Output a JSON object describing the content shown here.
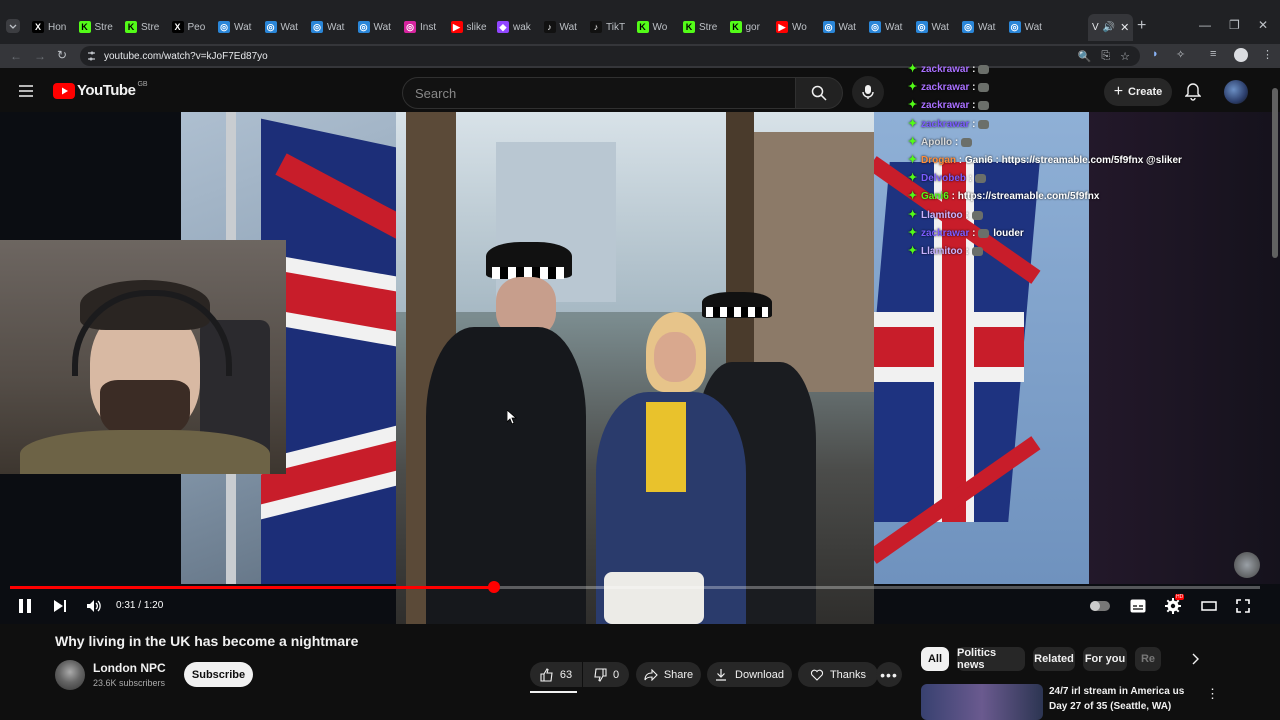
{
  "browser": {
    "tabs": [
      {
        "icon": "x",
        "label": "Hon"
      },
      {
        "icon": "kick",
        "label": "Stre"
      },
      {
        "icon": "kick",
        "label": "Stre"
      },
      {
        "icon": "x",
        "label": "Peo"
      },
      {
        "icon": "wat",
        "label": "Wat"
      },
      {
        "icon": "wat",
        "label": "Wat"
      },
      {
        "icon": "wat",
        "label": "Wat"
      },
      {
        "icon": "wat",
        "label": "Wat"
      },
      {
        "icon": "insta",
        "label": "Inst"
      },
      {
        "icon": "yt",
        "label": "slike"
      },
      {
        "icon": "twitch",
        "label": "wak"
      },
      {
        "icon": "tiktok",
        "label": "Wat"
      },
      {
        "icon": "tiktok",
        "label": "TikT"
      },
      {
        "icon": "kick",
        "label": "Wo"
      },
      {
        "icon": "kick",
        "label": "Stre"
      },
      {
        "icon": "kick",
        "label": "gor"
      },
      {
        "icon": "yt",
        "label": "Wo"
      },
      {
        "icon": "wat",
        "label": "Wat"
      },
      {
        "icon": "wat",
        "label": "Wat"
      },
      {
        "icon": "wat",
        "label": "Wat"
      },
      {
        "icon": "wat",
        "label": "Wat"
      },
      {
        "icon": "wat",
        "label": "Wat"
      }
    ],
    "active_tab_label": "V",
    "url": "youtube.com/watch?v=kJoF7Ed87yo"
  },
  "youtube": {
    "logo_text": "YouTube",
    "region": "GB",
    "search_placeholder": "Search",
    "create_label": "Create"
  },
  "chat": [
    {
      "user": "zackrawar",
      "msg": "",
      "color": "#a970ff"
    },
    {
      "user": "zackrawar",
      "msg": "",
      "color": "#a970ff"
    },
    {
      "user": "zackrawar",
      "msg": "",
      "color": "#a970ff"
    },
    {
      "user": "zackrawar",
      "msg": "",
      "color": "#7a5cff"
    },
    {
      "user": "Apollo",
      "msg": "",
      "color": "#d9d9d9"
    },
    {
      "user": "Drogan",
      "msg": "Gani6 : https://streamable.com/5f9fnx @sliker",
      "color": "#ff8c3a"
    },
    {
      "user": "Delvobeb",
      "msg": "",
      "color": "#7a5cff"
    },
    {
      "user": "Gani6",
      "msg": "https://streamable.com/5f9fnx",
      "color": "#53fc18"
    },
    {
      "user": "Llamitoo",
      "msg": "",
      "color": "#c8b3ff"
    },
    {
      "user": "zackrawar",
      "msg": "louder",
      "color": "#7a5cff"
    },
    {
      "user": "Llamitoo",
      "msg": "",
      "color": "#c8b3ff"
    }
  ],
  "player": {
    "current_time": "0:31",
    "duration": "1:20",
    "progress": 0.3875
  },
  "video": {
    "title": "Why living in the UK has become a nightmare",
    "channel": "London NPC",
    "subscribers": "23.6K subscribers",
    "subscribe_label": "Subscribe",
    "likes": "63",
    "dislikes": "0",
    "share_label": "Share",
    "download_label": "Download",
    "thanks_label": "Thanks"
  },
  "chips": [
    "All",
    "Politics news",
    "Related",
    "For you",
    "Re"
  ],
  "recommended": {
    "title": "24/7 irl stream in America us",
    "subtitle": "Day 27 of 35 (Seattle, WA)"
  },
  "colors": {
    "youtube_red": "#ff0000",
    "kick_green": "#53fc18",
    "background": "#0f0f0f"
  }
}
